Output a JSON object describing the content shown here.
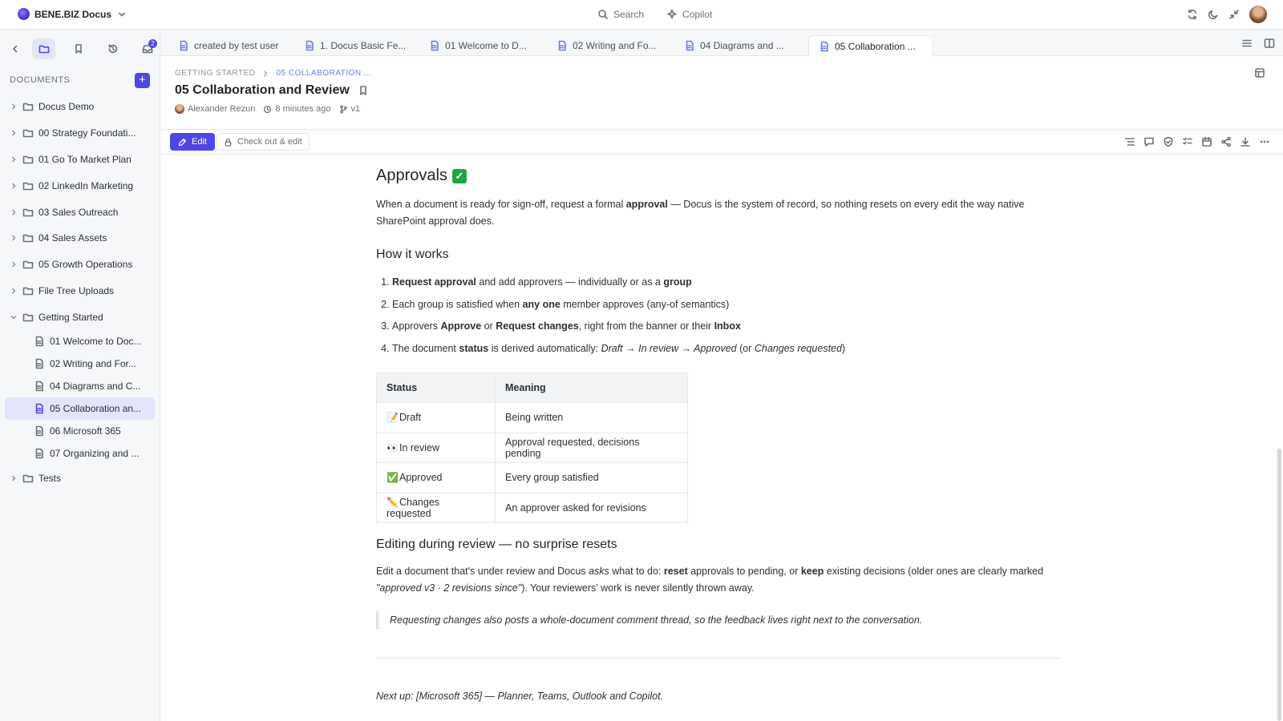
{
  "app": {
    "name": "BENE.BIZ Docus"
  },
  "top_center": {
    "search": "Search",
    "copilot": "Copilot"
  },
  "sidebar": {
    "inbox_badge": "2",
    "documents_label": "DOCUMENTS",
    "folders": [
      "Docus Demo",
      "00 Strategy Foundati...",
      "01 Go To Market Plan",
      "02 LinkedIn Marketing",
      "03 Sales Outreach",
      "04 Sales Assets",
      "05 Growth Operations",
      "File Tree Uploads"
    ],
    "open_folder": "Getting Started",
    "children": [
      "01 Welcome to Doc...",
      "02 Writing and For...",
      "04 Diagrams and C...",
      "05 Collaboration an...",
      "06 Microsoft 365",
      "07 Organizing and ..."
    ],
    "last_folder": "Tests"
  },
  "tabs": [
    "created by test user",
    "1. Docus Basic Fe...",
    "01 Welcome to D...",
    "02 Writing and Fo...",
    "04 Diagrams and ...",
    "05 Collaboration ..."
  ],
  "doc": {
    "breadcrumb_root": "GETTING STARTED",
    "breadcrumb_current": "05 COLLABORATION ...",
    "title": "05 Collaboration and Review",
    "author": "Alexander Rezun",
    "updated": "8 minutes ago",
    "version": "v1"
  },
  "toolbar": {
    "edit": "Edit",
    "checkout": "Check out & edit"
  },
  "content": {
    "heading": "Approvals",
    "intro_a": "When a document is ready for sign-off, request a formal ",
    "intro_b": "approval",
    "intro_c": " — Docus is the system of record, so nothing resets on every edit the way native SharePoint approval does.",
    "how_heading": "How it works",
    "step1": {
      "a": "Request approval",
      "b": " and add approvers — individually or as a ",
      "c": "group"
    },
    "step2": {
      "a": "Each group is satisfied when ",
      "b": "any one",
      "c": " member approves (any-of semantics)"
    },
    "step3": {
      "a": "Approvers ",
      "b": "Approve",
      "c": " or ",
      "d": "Request changes",
      "e": ", right from the banner or their ",
      "f": "Inbox"
    },
    "step4": {
      "a": "The document ",
      "b": "status",
      "c": " is derived automatically: ",
      "d": "Draft → In review → Approved",
      "e": " (or ",
      "f": "Changes requested",
      "g": ")"
    },
    "table": {
      "headers": [
        "Status",
        "Meaning"
      ],
      "rows": [
        {
          "emoji": "📝",
          "status": "Draft",
          "meaning": "Being written"
        },
        {
          "emoji": "👀",
          "status": "In review",
          "meaning": "Approval requested, decisions pending"
        },
        {
          "emoji": "✅",
          "status": "Approved",
          "meaning": "Every group satisfied"
        },
        {
          "emoji": "✏️",
          "status": "Changes requested",
          "meaning": "An approver asked for revisions"
        }
      ]
    },
    "edit_heading": "Editing during review — no surprise resets",
    "edit_p": {
      "a": "Edit a document that's under review and Docus ",
      "b": "asks",
      "c": " what to do: ",
      "d": "reset",
      "e": " approvals to pending, or ",
      "f": "keep",
      "g": " existing decisions (older ones are clearly marked ",
      "h": "\"approved v3 · 2 revisions since\"",
      "i": "). Your reviewers' work is never silently thrown away."
    },
    "quote": "Requesting changes also posts a whole-document comment thread, so the feedback lives right next to the conversation.",
    "next": "Next up: [Microsoft 365] — Planner, Teams, Outlook and Copilot."
  },
  "colors": {
    "accent": "#4f46e5",
    "check_green": "#22a447"
  }
}
